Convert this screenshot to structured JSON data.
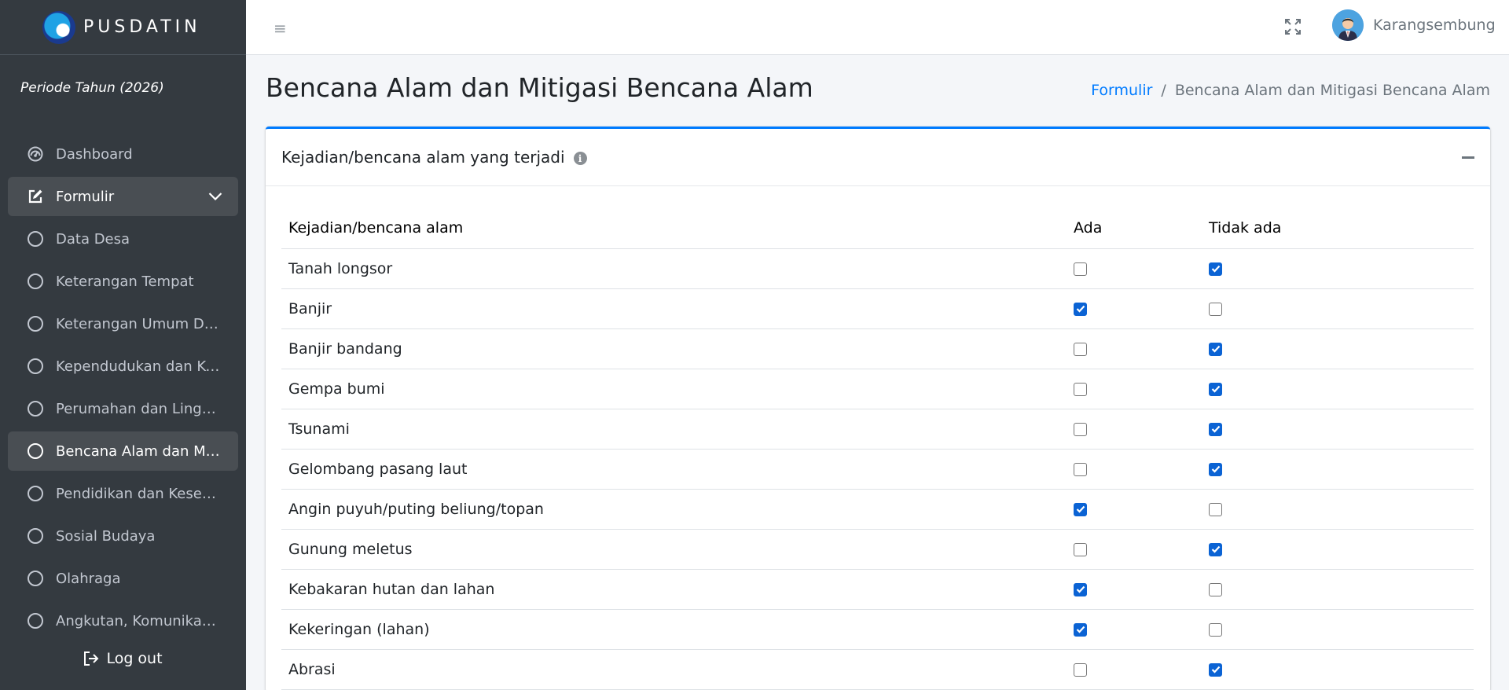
{
  "brand": {
    "name": "PUSDATIN"
  },
  "sidebar": {
    "periode": "Periode Tahun (2026)",
    "items": [
      {
        "label": "Dashboard"
      },
      {
        "label": "Formulir"
      },
      {
        "label": "Data Desa"
      },
      {
        "label": "Keterangan Tempat"
      },
      {
        "label": "Keterangan Umum Desa"
      },
      {
        "label": "Kependudukan dan Ketenagakerjaan"
      },
      {
        "label": "Perumahan dan Lingkungan Hidup"
      },
      {
        "label": "Bencana Alam dan Mitigasi Bencana Alam"
      },
      {
        "label": "Pendidikan dan Kesehatan"
      },
      {
        "label": "Sosial Budaya"
      },
      {
        "label": "Olahraga"
      },
      {
        "label": "Angkutan, Komunikasi, dan Informasi"
      }
    ],
    "logout_label": "Log out"
  },
  "navbar": {
    "username": "Karangsembung"
  },
  "page": {
    "title": "Bencana Alam dan Mitigasi Bencana Alam",
    "breadcrumb": {
      "parent": "Formulir",
      "separator": "/",
      "current": "Bencana Alam dan Mitigasi Bencana Alam"
    }
  },
  "card": {
    "title": "Kejadian/bencana alam yang terjadi",
    "table": {
      "headers": [
        "Kejadian/bencana alam",
        "Ada",
        "Tidak ada"
      ],
      "rows": [
        {
          "name": "Tanah longsor",
          "ada": false,
          "tidak_ada": true
        },
        {
          "name": "Banjir",
          "ada": true,
          "tidak_ada": false
        },
        {
          "name": "Banjir bandang",
          "ada": false,
          "tidak_ada": true
        },
        {
          "name": "Gempa bumi",
          "ada": false,
          "tidak_ada": true
        },
        {
          "name": "Tsunami",
          "ada": false,
          "tidak_ada": true
        },
        {
          "name": "Gelombang pasang laut",
          "ada": false,
          "tidak_ada": true
        },
        {
          "name": "Angin puyuh/puting beliung/topan",
          "ada": true,
          "tidak_ada": false
        },
        {
          "name": "Gunung meletus",
          "ada": false,
          "tidak_ada": true
        },
        {
          "name": "Kebakaran hutan dan lahan",
          "ada": true,
          "tidak_ada": false
        },
        {
          "name": "Kekeringan (lahan)",
          "ada": true,
          "tidak_ada": false
        },
        {
          "name": "Abrasi",
          "ada": false,
          "tidak_ada": true
        }
      ]
    }
  },
  "colors": {
    "sidebar_bg": "#343a40",
    "accent": "#007bff",
    "checkbox_checked": "#0b63d4"
  }
}
